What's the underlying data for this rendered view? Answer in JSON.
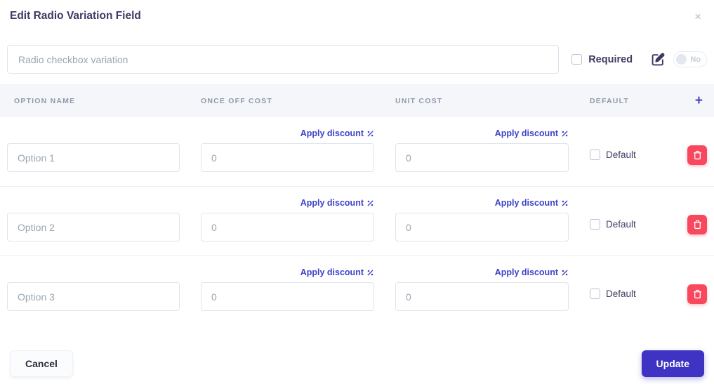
{
  "modal": {
    "title": "Edit Radio Variation Field",
    "close_glyph": "×"
  },
  "field": {
    "name_value": "Radio checkbox variation",
    "required_label": "Required",
    "toggle_state_label": "No"
  },
  "table": {
    "headers": {
      "option_name": "OPTION NAME",
      "once_off_cost": "ONCE OFF COST",
      "unit_cost": "UNIT COST",
      "default": "DEFAULT"
    },
    "add_button_glyph": "+",
    "apply_discount_label": "Apply discount",
    "default_label": "Default",
    "rows": [
      {
        "option_name": "Option 1",
        "once_off_cost": "0",
        "unit_cost": "0",
        "default_checked": false
      },
      {
        "option_name": "Option 2",
        "once_off_cost": "0",
        "unit_cost": "0",
        "default_checked": false
      },
      {
        "option_name": "Option 3",
        "once_off_cost": "0",
        "unit_cost": "0",
        "default_checked": false
      }
    ]
  },
  "footer": {
    "cancel_label": "Cancel",
    "update_label": "Update"
  },
  "colors": {
    "accent": "#3e33c2",
    "link": "#3d43c9",
    "danger": "#f8485e",
    "title_text": "#3d3865",
    "muted_text": "#9aa5b5",
    "header_bg": "#f4f6fa"
  }
}
